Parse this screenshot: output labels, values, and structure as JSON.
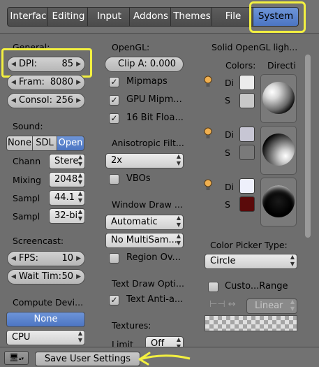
{
  "tabs": [
    "Interfac",
    "Editing",
    "Input",
    "Addons",
    "Themes",
    "File",
    "System"
  ],
  "general": {
    "heading": "General:",
    "dpi_label": "DPI:",
    "dpi_value": "85",
    "frames_label": "Fram:",
    "frames_value": "8080",
    "console_label": "Consol:",
    "console_value": "256"
  },
  "sound": {
    "heading": "Sound:",
    "buttons": [
      "None",
      "SDL",
      "Open"
    ],
    "channels_label": "Chann",
    "channels_value": "Stere",
    "mixing_label": "Mixing",
    "mixing_value": "2048",
    "samplerate_label": "Sampl",
    "samplerate_value": "44.1",
    "sampleformat_label": "Sampl",
    "sampleformat_value": "32-bi"
  },
  "screencast": {
    "heading": "Screencast:",
    "fps_label": "FPS:",
    "fps_value": "10",
    "wait_label": "Wait Tim:",
    "wait_value": "50"
  },
  "compute": {
    "heading": "Compute Devi...",
    "none_button": "None",
    "device_value": "CPU"
  },
  "opengl": {
    "heading": "OpenGL:",
    "clip_alpha": "Clip A: 0.000",
    "mipmaps": "Mipmaps",
    "gpu_mipmap": "GPU Mipm...",
    "float_textures": "16 Bit Floa...",
    "aniso_heading": "Anisotropic Filt...",
    "aniso_value": "2x",
    "vbos": "VBOs",
    "window_draw_heading": "Window Draw ...",
    "window_draw_value": "Automatic",
    "multisample_value": "No MultiSam...",
    "region_overlap": "Region Ov...",
    "text_draw_heading": "Text Draw Opti...",
    "text_antialias": "Text Anti-a...",
    "textures_heading": "Textures:",
    "limit_label": "Limit",
    "limit_value": "Off"
  },
  "solid_lights": {
    "heading": "Solid OpenGL ligh...",
    "colors_label": "Colors:",
    "direction_label": "Directi",
    "lights": [
      {
        "diffuse_label": "Di",
        "specular_label": "S",
        "diffuse": "#ececec",
        "specular": "#c8c8c8"
      },
      {
        "diffuse_label": "Di",
        "specular_label": "S",
        "diffuse": "#c7c6d4",
        "specular": "#7a7a7a"
      },
      {
        "diffuse_label": "Di",
        "specular_label": "S",
        "diffuse": "#eef0fb",
        "specular": "#5a0a0a"
      }
    ]
  },
  "color_picker": {
    "heading": "Color Picker Type:",
    "value": "Circle",
    "custom_range": "Custo...Range",
    "interpolation": "Linear"
  },
  "bottom": {
    "save_label": "Save User Settings"
  },
  "colors": {
    "tab_active": "#5a84cf",
    "highlight": "#f3f040",
    "panel": "#6e6e6e"
  }
}
